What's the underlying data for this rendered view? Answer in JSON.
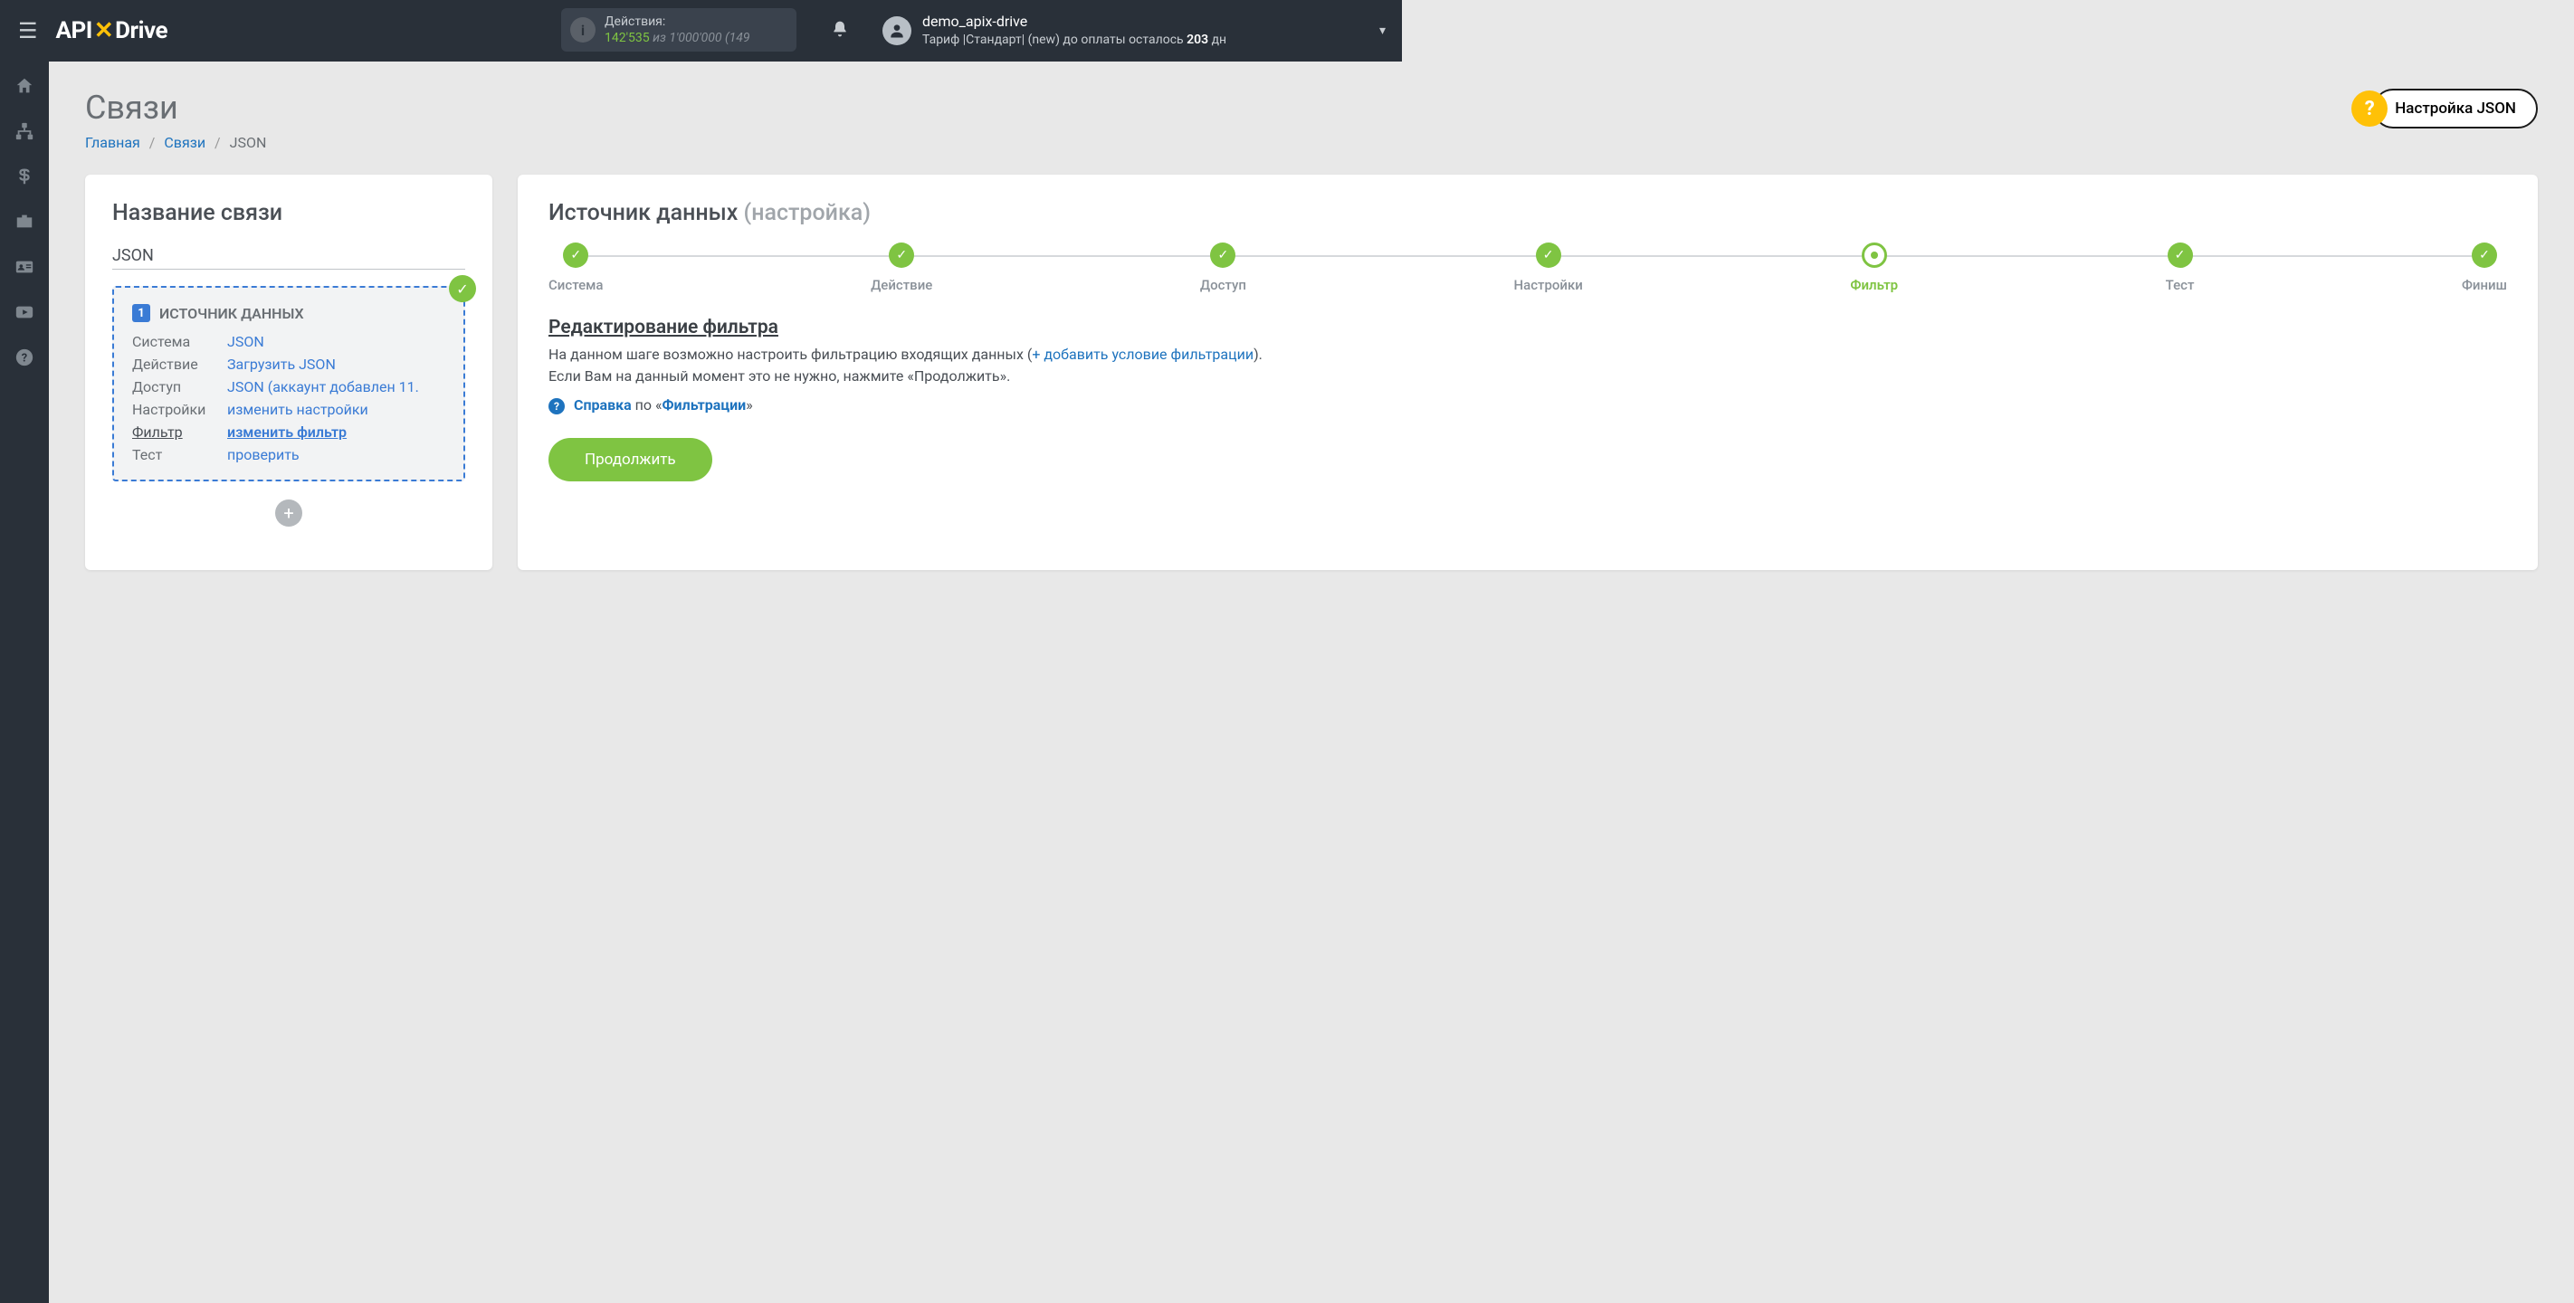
{
  "header": {
    "actions_label": "Действия:",
    "actions_count": "142'535",
    "actions_of": "из",
    "actions_total": "1'000'000",
    "actions_extra": "(149",
    "user_name": "demo_apix-drive",
    "tariff_prefix": "Тариф |Стандарт| (new) до оплаты осталось ",
    "tariff_days": "203",
    "tariff_suffix": " дн"
  },
  "page": {
    "title": "Связи",
    "btn_json": "Настройка JSON"
  },
  "breadcrumbs": {
    "home": "Главная",
    "links": "Связи",
    "current": "JSON"
  },
  "left_card": {
    "title": "Название связи",
    "value": "JSON",
    "source_title": "ИСТОЧНИК ДАННЫХ",
    "rows": {
      "system_label": "Система",
      "system_value": "JSON",
      "action_label": "Действие",
      "action_value": "Загрузить JSON",
      "access_label": "Доступ",
      "access_value": "JSON (аккаунт добавлен 11.",
      "settings_label": "Настройки",
      "settings_value": "изменить настройки",
      "filter_label": "Фильтр",
      "filter_value": "изменить фильтр",
      "test_label": "Тест",
      "test_value": "проверить"
    }
  },
  "right_card": {
    "title": "Источник данных",
    "title_sub": "(настройка)",
    "steps": [
      "Система",
      "Действие",
      "Доступ",
      "Настройки",
      "Фильтр",
      "Тест",
      "Финиш"
    ],
    "filter_title": "Редактирование фильтра",
    "filter_text1": "На данном шаге возможно настроить фильтрацию входящих данных (",
    "filter_link": "+ добавить условие фильтрации",
    "filter_text2": ").",
    "filter_text3": "Если Вам на данный момент это не нужно, нажмите «Продолжить».",
    "help_link_prefix": "Справка",
    "help_link_mid": " по «",
    "help_link_bold": "Фильтрации",
    "help_link_suffix": "»",
    "btn_continue": "Продолжить"
  }
}
